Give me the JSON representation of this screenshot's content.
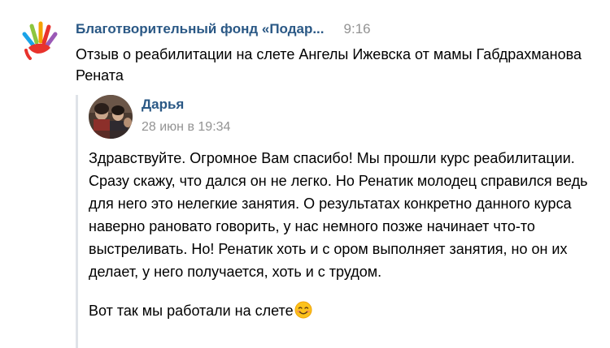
{
  "post": {
    "author": "Благотворительный фонд «Подар...",
    "time": "9:16",
    "text": "Отзыв о реабилитации на слете Ангелы Ижевска от мамы Габдрахманова Рената"
  },
  "quote": {
    "author": "Дарья",
    "date": "28 июн в 19:34",
    "paragraph_1": "Здравствуйте. Огромное Вам спасибо! Мы прошли курс реабилитации. Сразу скажу, что дался он не легко. Но Ренатик молодец справился ведь для него это нелегкие занятия. О результатах конкретно данного курса наверно рановато говорить, у нас немного позже начинает что-то выстреливать. Но! Ренатик хоть и с ором выполняет занятия, но он их делает, у него получается, хоть и с трудом.",
    "paragraph_2": "Вот так мы работали на слете"
  },
  "icons": {
    "logo": "hand-logo-icon",
    "avatar": "user-avatar",
    "emoji": "smiling-face-emoji-icon"
  },
  "colors": {
    "link": "#2a5885",
    "muted": "#939393",
    "quote_bar": "#dfe3e8"
  }
}
